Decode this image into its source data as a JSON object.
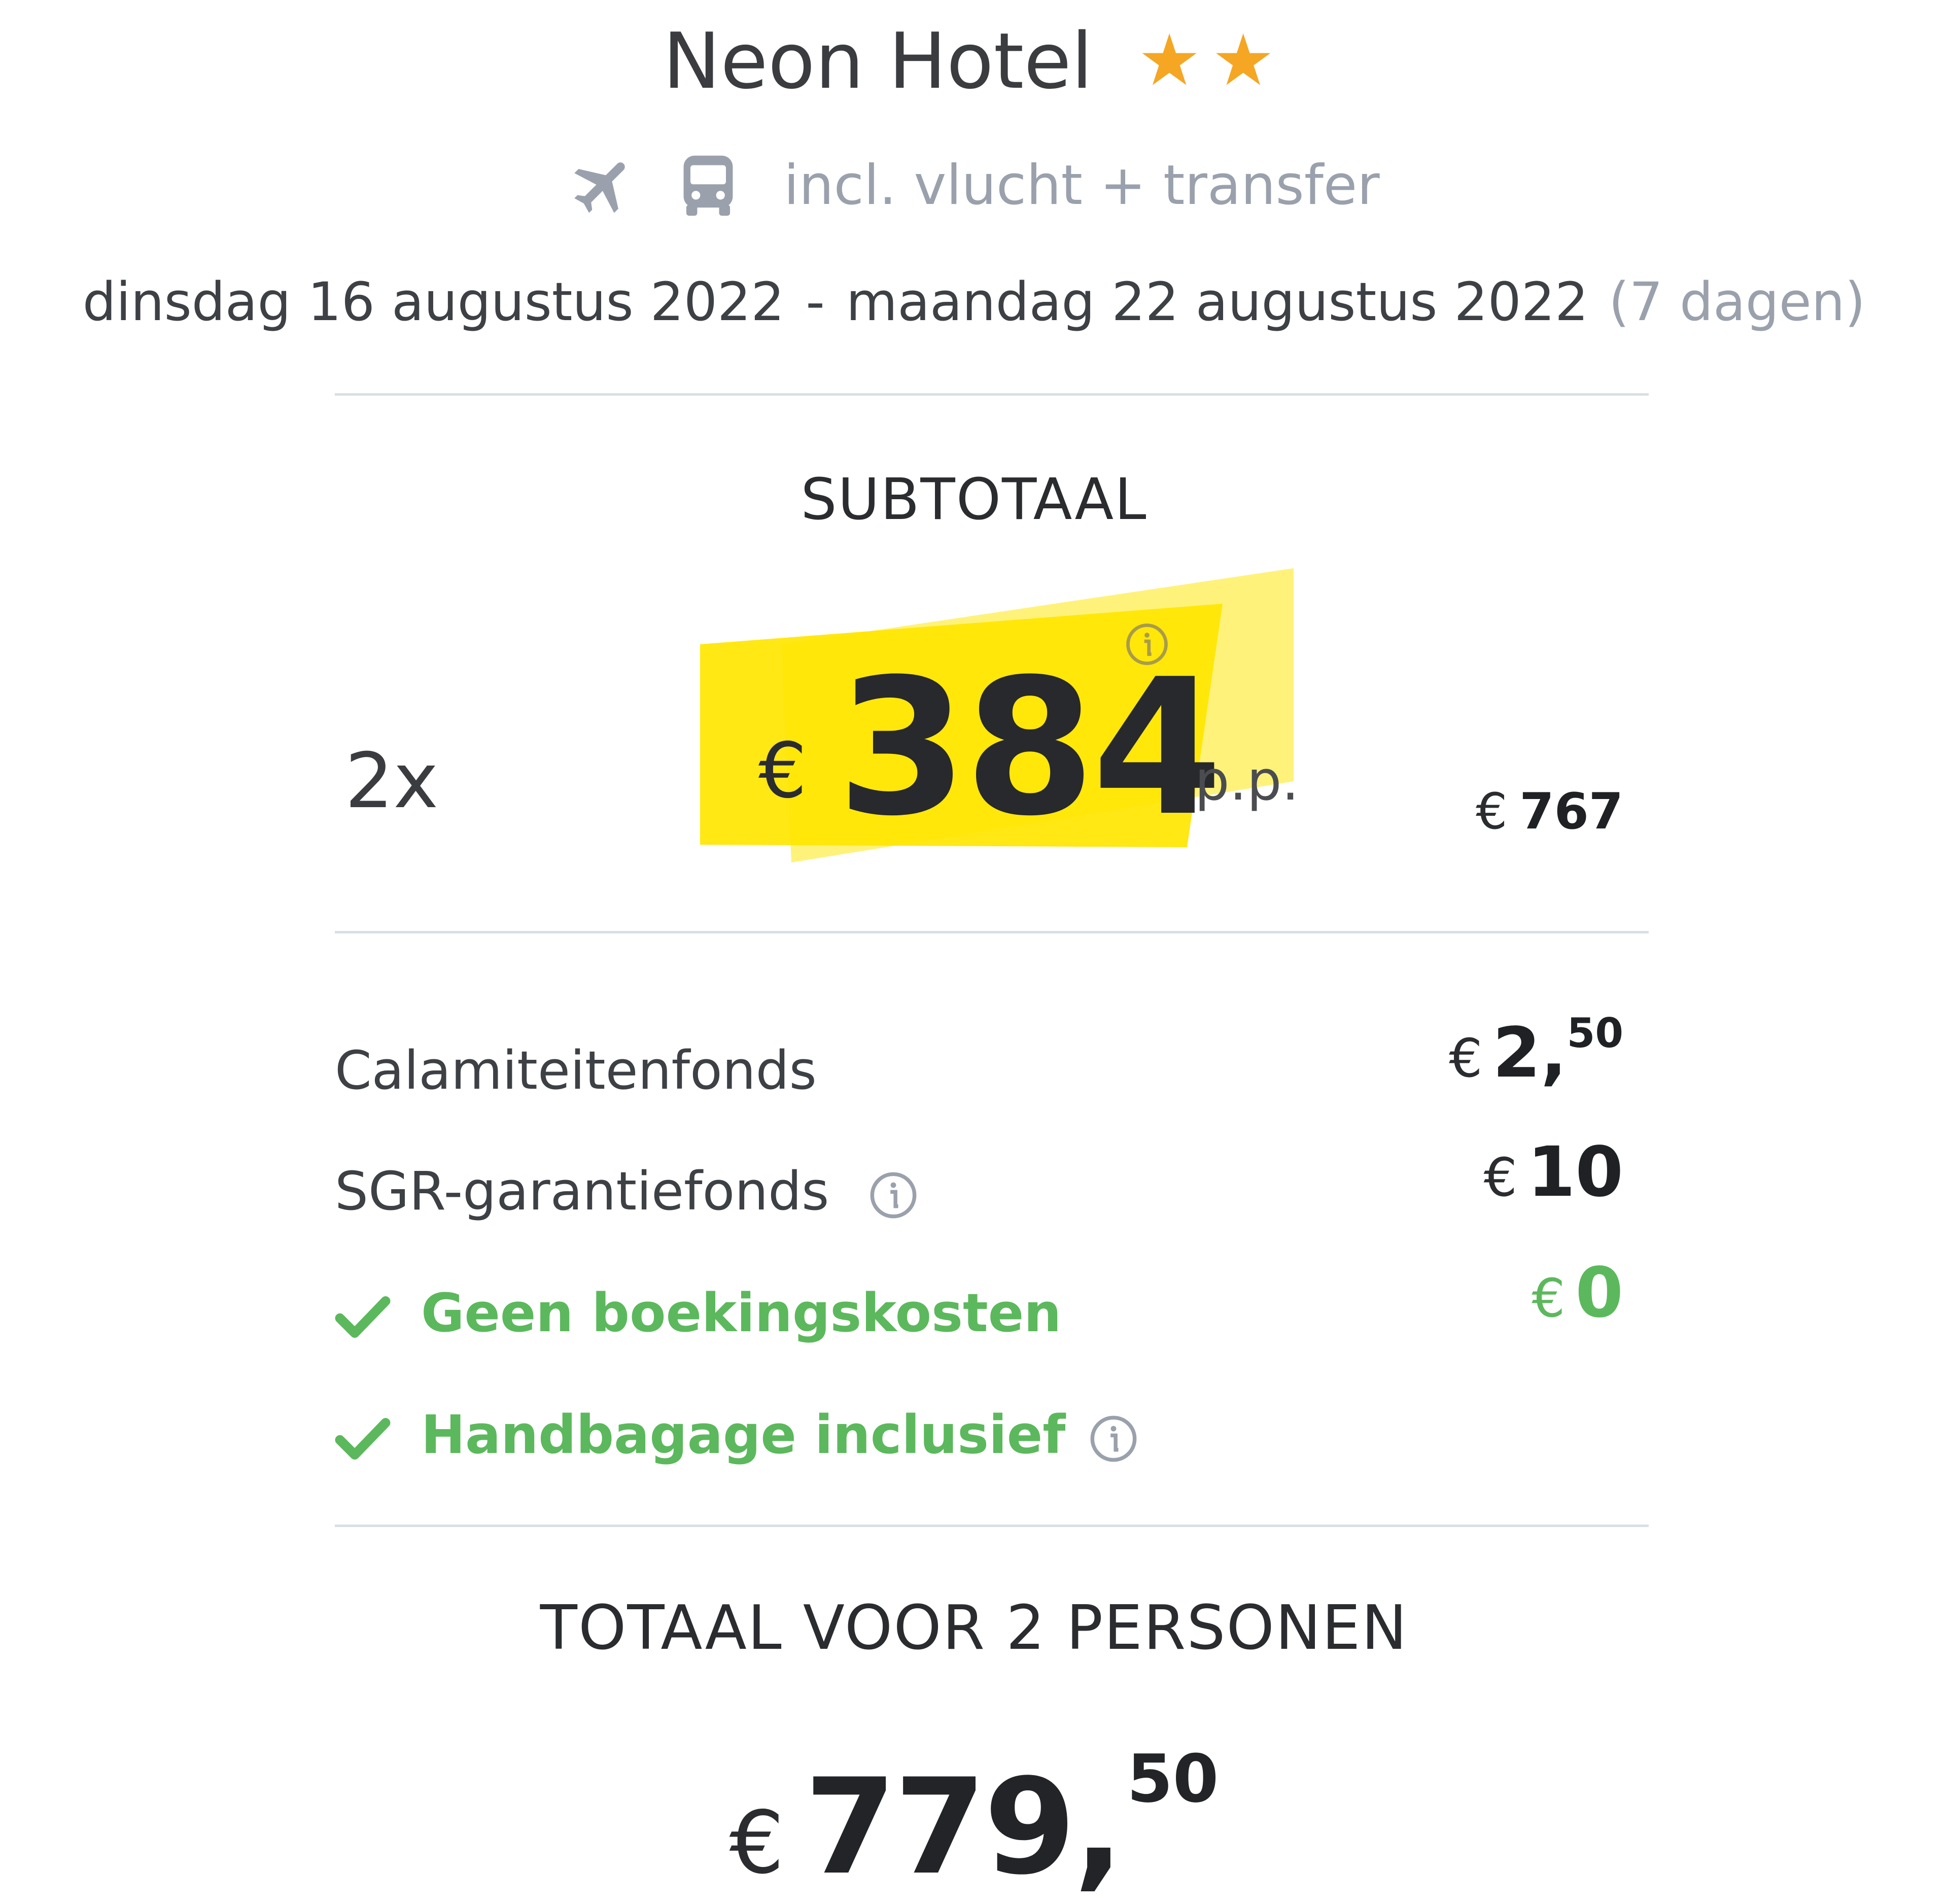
{
  "hotel": {
    "name": "Neon Hotel",
    "star_icon": "star-icon",
    "star_rating": 2,
    "star_color": "#f5a623"
  },
  "transport": {
    "icons": [
      "plane-icon",
      "bus-icon"
    ],
    "label": "incl. vlucht + transfer"
  },
  "dates": {
    "start": "dinsdag 16 augustus 2022",
    "separator": "-",
    "end": "maandag 22 augustus 2022",
    "duration": "(7 dagen)"
  },
  "subtotal": {
    "heading": "SUBTOTAAL",
    "quantity": "2x",
    "currency": "€",
    "price_per_person": "384",
    "per_person_label": "p.p.",
    "line_total": "767",
    "highlight_color": "#ffe600"
  },
  "fees": [
    {
      "label": "Calamiteitenfonds",
      "currency": "€",
      "amount": "2,",
      "cents": "50"
    },
    {
      "label": "SGR-garantiefonds",
      "currency": "€",
      "amount": "10",
      "info_icon": "info-icon"
    }
  ],
  "perks": [
    {
      "label": "Geen boekingskosten",
      "currency": "€",
      "amount": "0",
      "icon": "check-icon"
    },
    {
      "label": "Handbagage inclusief",
      "icon": "check-icon",
      "info_icon": "info-icon"
    }
  ],
  "total": {
    "heading": "TOTAAL VOOR 2 PERSONEN",
    "currency": "€",
    "amount": "779,",
    "cents": "50"
  },
  "colors": {
    "green": "#5cb85c",
    "muted": "#9aa1ad",
    "divider": "#d8e0e6"
  }
}
